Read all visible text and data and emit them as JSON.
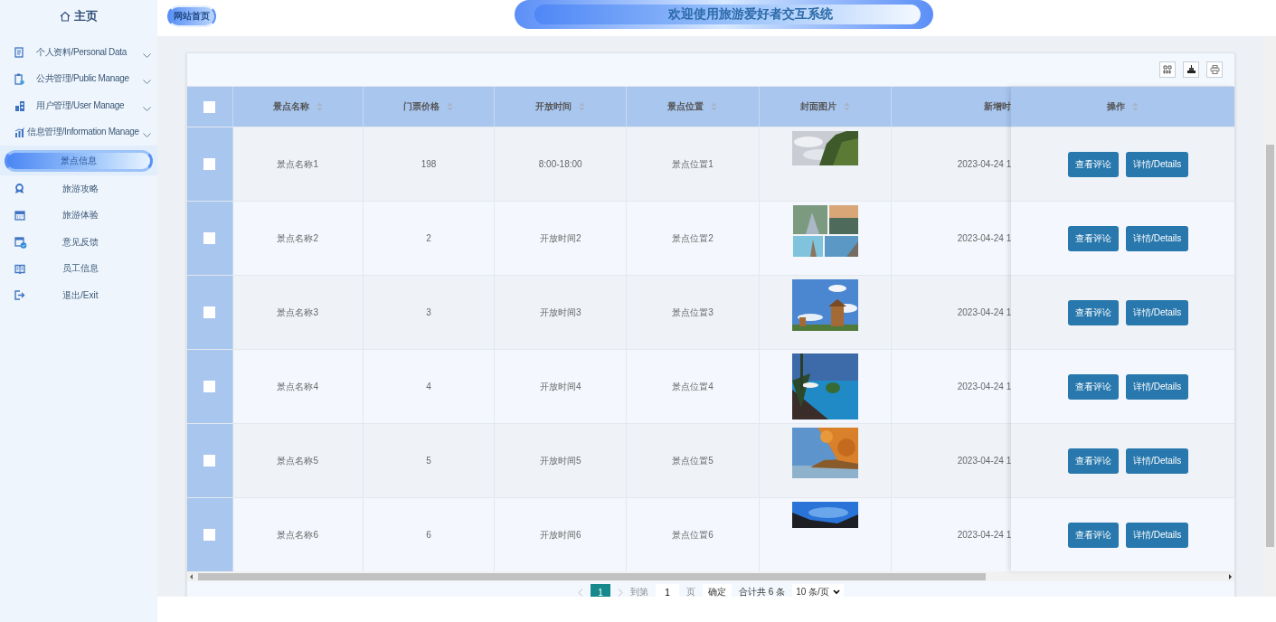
{
  "sidebar": {
    "title": "主页",
    "items": [
      {
        "kind": "group",
        "label": "个人资料/Personal Data"
      },
      {
        "kind": "group",
        "label": "公共管理/Public Manage"
      },
      {
        "kind": "group",
        "label": "用户管理/User Manage"
      },
      {
        "kind": "group",
        "label": "信息管理/Information Manage",
        "expanded": true,
        "children": [
          {
            "label": "景点信息",
            "selected": true
          },
          {
            "label": "旅游攻略",
            "selected": false
          },
          {
            "label": "旅游体验",
            "selected": false
          },
          {
            "label": "意见反馈",
            "selected": false
          },
          {
            "label": "员工信息",
            "selected": false
          }
        ]
      },
      {
        "kind": "link",
        "label": "退出/Exit"
      }
    ]
  },
  "header": {
    "home_link": "网站首页",
    "title": "欢迎使用旅游爱好者交互系统"
  },
  "table": {
    "select_all": {
      "checked": false
    },
    "columns": [
      "景点名称",
      "门票价格",
      "开放时间",
      "景点位置",
      "封面图片",
      "新增时"
    ],
    "actions_column": "操作",
    "rows": [
      {
        "selected": false,
        "name": "景点名称1",
        "price": "198",
        "open_time": "8:00-18:00",
        "location": "景点位置1",
        "added": "2023-04-24 1",
        "actions": [
          "查看评论",
          "详情/Details"
        ]
      },
      {
        "selected": false,
        "name": "景点名称2",
        "price": "2",
        "open_time": "开放时间2",
        "location": "景点位置2",
        "added": "2023-04-24 1",
        "actions": [
          "查看评论",
          "详情/Details"
        ]
      },
      {
        "selected": false,
        "name": "景点名称3",
        "price": "3",
        "open_time": "开放时间3",
        "location": "景点位置3",
        "added": "2023-04-24 1",
        "actions": [
          "查看评论",
          "详情/Details"
        ]
      },
      {
        "selected": false,
        "name": "景点名称4",
        "price": "4",
        "open_time": "开放时间4",
        "location": "景点位置4",
        "added": "2023-04-24 1",
        "actions": [
          "查看评论",
          "详情/Details"
        ]
      },
      {
        "selected": false,
        "name": "景点名称5",
        "price": "5",
        "open_time": "开放时间5",
        "location": "景点位置5",
        "added": "2023-04-24 1",
        "actions": [
          "查看评论",
          "详情/Details"
        ]
      },
      {
        "selected": false,
        "name": "景点名称6",
        "price": "6",
        "open_time": "开放时间6",
        "location": "景点位置6",
        "added": "2023-04-24 1",
        "actions": [
          "查看评论",
          "详情/Details"
        ]
      }
    ]
  },
  "pagination": {
    "pages": [
      {
        "label": "1",
        "selected": true
      }
    ],
    "goto_label": "到第",
    "goto_value": "1",
    "page_unit": "页",
    "confirm": "确定",
    "total": "合计共 6 条",
    "page_size": "10 条/页"
  }
}
